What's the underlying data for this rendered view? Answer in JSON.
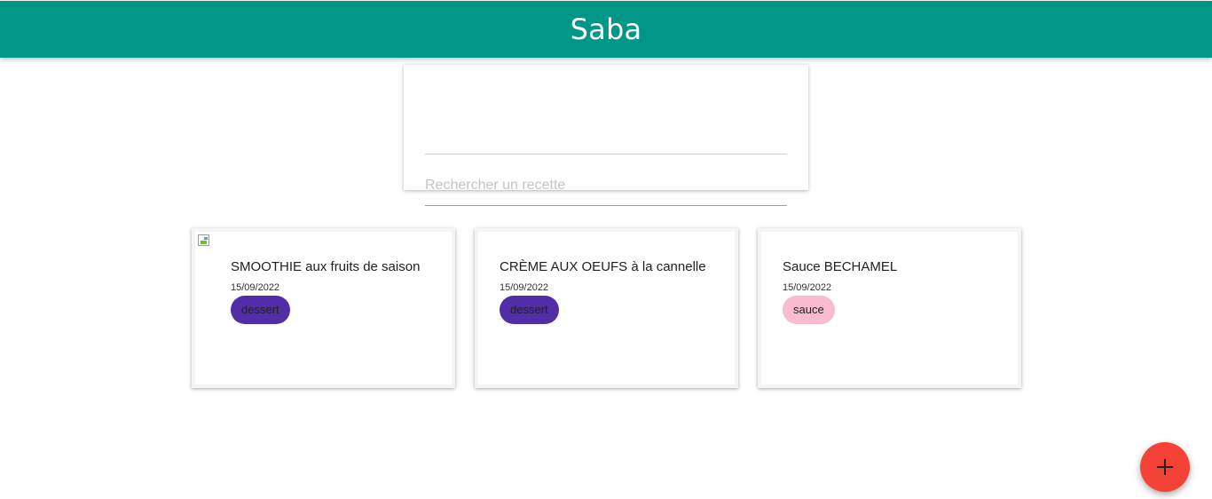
{
  "app": {
    "title": "Saba"
  },
  "search": {
    "placeholder": "Rechercher un recette",
    "value": ""
  },
  "recipes": [
    {
      "title": "SMOOTHIE aux fruits de saison",
      "date": "15/09/2022",
      "tag": "dessert",
      "has_image": true
    },
    {
      "title": "CRÈME AUX OEUFS à la cannelle",
      "date": "15/09/2022",
      "tag": "dessert",
      "has_image": false
    },
    {
      "title": "Sauce BECHAMEL",
      "date": "15/09/2022",
      "tag": "sauce",
      "has_image": false
    }
  ],
  "colors": {
    "header": "#009688",
    "tag_dessert": "#512da8",
    "tag_sauce": "#f8bbd0",
    "fab": "#f44336"
  },
  "fab": {
    "icon": "plus-icon"
  }
}
